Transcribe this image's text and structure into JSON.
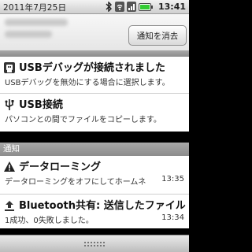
{
  "status_bar": {
    "date": "2011年7月25日",
    "time": "13:41",
    "icons": [
      "bluetooth-icon",
      "wifi-icon",
      "signal-icon",
      "battery-icon"
    ],
    "battery_color": "#33cc33"
  },
  "panel": {
    "clear_button_label": "通知を消去"
  },
  "sections": {
    "notifications_header": "通知"
  },
  "ongoing": [
    {
      "icon": "usb-debug-icon",
      "title": "USBデバッグが接続されました",
      "text": "USBデバッグを無効にする場合に選択します。"
    },
    {
      "icon": "usb-icon",
      "title": "USB接続",
      "text": "パソコンとの間でファイルをコピーします。"
    }
  ],
  "notifications": [
    {
      "icon": "warning-icon",
      "title": "データローミング",
      "text": "データローミングをオフにしてホームネ",
      "time": "13:35"
    },
    {
      "icon": "upload-icon",
      "title": "Bluetooth共有: 送信したファイル",
      "text": "1成功、0失敗しました。",
      "time": "13:34"
    }
  ]
}
